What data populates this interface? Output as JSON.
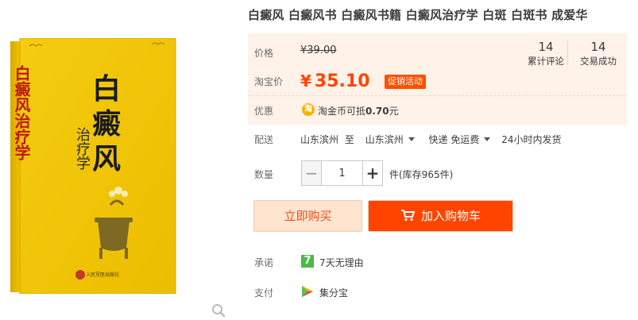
{
  "product": {
    "title": "白癜风 白癜风书 白癜风书籍 白癜风治疗学 白斑 白斑书 成爱华",
    "book_cover": {
      "title_line1": "白",
      "title_line2": "癜",
      "title_line3": "风",
      "subtitle": "治疗学",
      "red_side_title": "白癜风治疗学",
      "publisher": "人民军医出版社"
    }
  },
  "price": {
    "label": "价格",
    "original": "¥39.00",
    "promo_label": "淘宝价",
    "promo_currency": "¥",
    "promo_value": "35.10",
    "promo_tag": "促销活动"
  },
  "stats": [
    {
      "num": "14",
      "caption": "累计评论"
    },
    {
      "num": "14",
      "caption": "交易成功"
    }
  ],
  "discount": {
    "label": "优惠",
    "icon_glyph": "淘",
    "text_prefix": "淘金币可抵",
    "text_amount": "0.70",
    "text_suffix": "元"
  },
  "shipping": {
    "label": "配送",
    "from": "山东滨州",
    "to_word": "至",
    "to": "山东滨州",
    "method": "快递 免运费",
    "time": "24小时内发货"
  },
  "quantity": {
    "label": "数量",
    "minus": "−",
    "value": "1",
    "plus": "+",
    "stock": "件(库存965件)"
  },
  "actions": {
    "buy_now": "立即购买",
    "add_to_cart": "加入购物车"
  },
  "promise": {
    "label": "承诺",
    "icon_glyph": "7",
    "text": "7天无理由"
  },
  "payment": {
    "label": "支付",
    "text": "集分宝"
  },
  "colors": {
    "accent": "#ff4400",
    "price_bg": "#fff2e8",
    "book_yellow": "#f2c800",
    "seven_green": "#4cb948"
  }
}
